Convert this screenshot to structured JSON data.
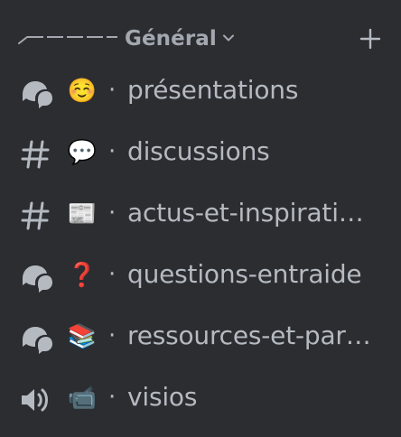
{
  "category": {
    "label": "Général",
    "chevron_icon": "chevron-down-icon",
    "add_icon": "plus-icon"
  },
  "colors": {
    "background": "#2b2d31",
    "text": "#b5bac1",
    "category_text": "#a3a8b0"
  },
  "channels": [
    {
      "type": "forum",
      "icon": "forum-icon",
      "emoji": "☺️",
      "separator": "·",
      "name": "présentations"
    },
    {
      "type": "text",
      "icon": "hashtag-icon",
      "emoji": "💬",
      "separator": "·",
      "name": "discussions"
    },
    {
      "type": "text",
      "icon": "hashtag-icon",
      "emoji": "📰",
      "separator": "·",
      "name": "actus-et-inspirations"
    },
    {
      "type": "forum",
      "icon": "forum-icon",
      "emoji": "❓",
      "separator": "·",
      "name": "questions-entraide"
    },
    {
      "type": "forum",
      "icon": "forum-icon",
      "emoji": "📚",
      "separator": "·",
      "name": "ressources-et-partages"
    },
    {
      "type": "voice",
      "icon": "speaker-icon",
      "emoji": "📹",
      "separator": "·",
      "name": "visios"
    }
  ]
}
